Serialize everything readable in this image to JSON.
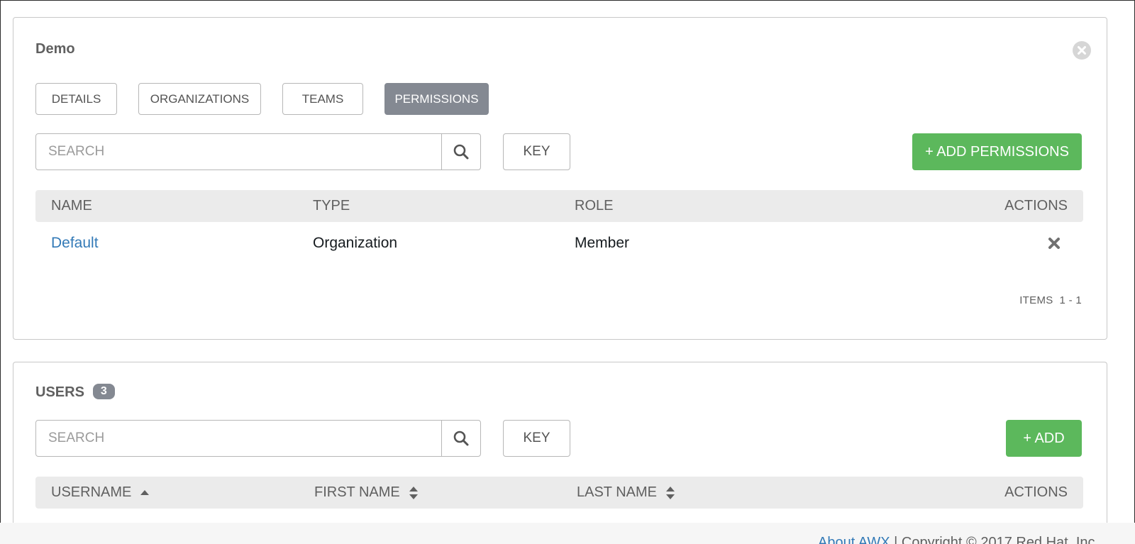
{
  "demo_panel": {
    "title": "Demo",
    "tabs": [
      {
        "label": "DETAILS",
        "active": false
      },
      {
        "label": "ORGANIZATIONS",
        "active": false
      },
      {
        "label": "TEAMS",
        "active": false
      },
      {
        "label": "PERMISSIONS",
        "active": true
      }
    ],
    "search_placeholder": "SEARCH",
    "key_label": "KEY",
    "add_label": "+ ADD PERMISSIONS",
    "columns": [
      "NAME",
      "TYPE",
      "ROLE",
      "ACTIONS"
    ],
    "rows": [
      {
        "name": "Default",
        "type": "Organization",
        "role": "Member"
      }
    ],
    "items_label": "ITEMS",
    "items_range": "1 - 1"
  },
  "users_panel": {
    "title": "USERS",
    "count": "3",
    "search_placeholder": "SEARCH",
    "key_label": "KEY",
    "add_label": "+ ADD",
    "columns": [
      "USERNAME",
      "FIRST NAME",
      "LAST NAME",
      "ACTIONS"
    ]
  },
  "footer": {
    "about_link": "About AWX",
    "separator": "|",
    "copyright": "Copyright © 2017 Red Hat, Inc."
  },
  "colors": {
    "accent_green": "#5cb85c",
    "active_tab": "#848992",
    "link_blue": "#337ab7"
  }
}
